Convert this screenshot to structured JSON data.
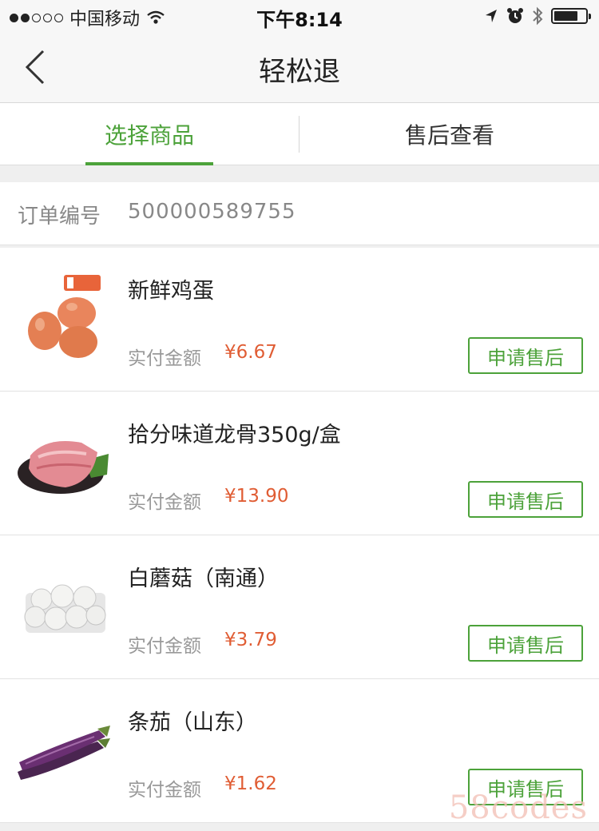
{
  "status_bar": {
    "carrier": "中国移动",
    "time": "下午8:14",
    "signal_icon": "signal-dots-icon",
    "wifi_icon": "wifi-icon",
    "location_icon": "location-arrow-icon",
    "alarm_icon": "alarm-clock-icon",
    "bluetooth_icon": "bluetooth-icon",
    "battery_icon": "battery-icon",
    "battery_level": 0.75
  },
  "nav": {
    "back_icon": "chevron-left-icon",
    "title": "轻松退"
  },
  "tabs": [
    {
      "label": "选择商品",
      "active": true
    },
    {
      "label": "售后查看",
      "active": false
    }
  ],
  "order": {
    "label": "订单编号",
    "number": "500000589755"
  },
  "items": [
    {
      "name": "新鲜鸡蛋",
      "paid_label": "实付金额",
      "price": "¥6.67",
      "button": "申请售后",
      "image": "eggs-image"
    },
    {
      "name": "拾分味道龙骨350g/盒",
      "paid_label": "实付金额",
      "price": "¥13.90",
      "button": "申请售后",
      "image": "pork-bone-image"
    },
    {
      "name": "白蘑菇（南通）",
      "paid_label": "实付金额",
      "price": "¥3.79",
      "button": "申请售后",
      "image": "mushrooms-image"
    },
    {
      "name": "条茄（山东）",
      "paid_label": "实付金额",
      "price": "¥1.62",
      "button": "申请售后",
      "image": "eggplant-image"
    }
  ],
  "watermark": "58codes",
  "colors": {
    "accent": "#4ca23a",
    "price": "#e05d34"
  }
}
